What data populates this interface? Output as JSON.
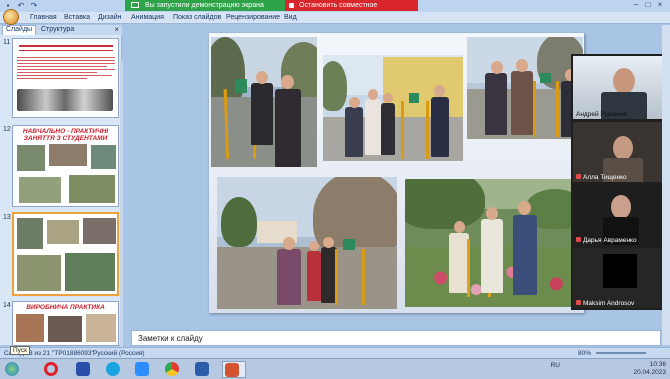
{
  "app": {
    "share_notice": "Вы запустили демонстрацию экрана",
    "stop_share": "Остановить совместное использование"
  },
  "ribbon": {
    "tabs": [
      "Главная",
      "Вставка",
      "Дизайн",
      "Анимация",
      "Показ слайдов",
      "Рецензирование",
      "Вид"
    ]
  },
  "left_pane": {
    "tabs": [
      "Слайды",
      "Структура"
    ],
    "slides": [
      {
        "num": "11",
        "title": ""
      },
      {
        "num": "12",
        "title": "НАВЧАЛЬНО - ПРАКТИЧНІ ЗАНЯТТЯ З СТУДЕНТАМИ"
      },
      {
        "num": "13",
        "title": ""
      },
      {
        "num": "14",
        "title": "ВИРОБНИЧА ПРАКТИКА"
      }
    ]
  },
  "notes": {
    "placeholder": "Заметки к слайду"
  },
  "statusbar": {
    "slide": "Слайд 13 из 21",
    "theme": "\"TP01886093\"",
    "language": "Русский (Россия)",
    "zoom": "80%",
    "tooltip": "Пуск"
  },
  "video": {
    "participants": [
      {
        "name": "Андрей Романча",
        "muted": false
      },
      {
        "name": "Алла Тищенко",
        "muted": true
      },
      {
        "name": "Дарья Авраменко",
        "muted": true
      },
      {
        "name": "Maksim Androsov",
        "muted": true
      }
    ]
  },
  "taskbar": {
    "lang": "RU",
    "time": "10:36",
    "date": "20.04.2023"
  },
  "colors": {
    "share_green": "#2fa34a",
    "stop_red": "#d9262c",
    "selected_slide": "#f0a23a"
  }
}
